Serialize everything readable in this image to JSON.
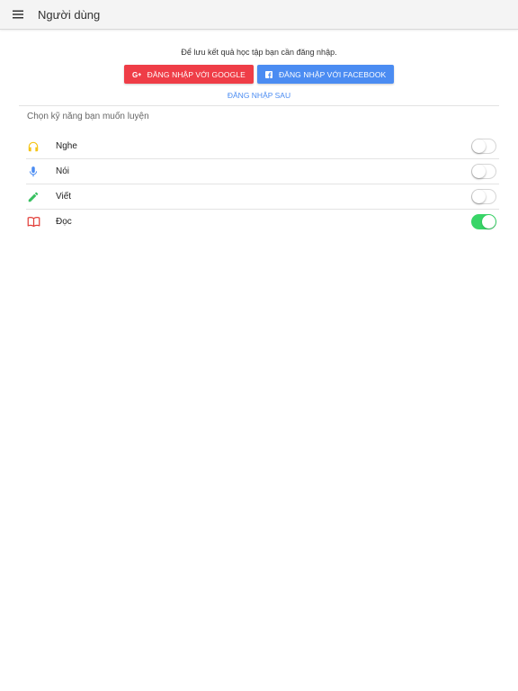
{
  "appbar": {
    "title": "Người dùng",
    "menu_icon": "menu-icon"
  },
  "login": {
    "message": "Để lưu kết quả học tập bạn cần đăng nhập.",
    "google_label": "ĐĂNG NHẬP VỚI GOOGLE",
    "google_icon": "google-plus-icon",
    "google_color": "#ef3d47",
    "facebook_label": "ĐĂNG NHẬP VỚI FACEBOOK",
    "facebook_icon": "facebook-icon",
    "facebook_color": "#4b8cf2",
    "later_label": "ĐĂNG NHẬP SAU"
  },
  "skills": {
    "section_label": "Chọn kỹ năng bạn muốn luyện",
    "items": [
      {
        "label": "Nghe",
        "icon": "headphones-icon",
        "icon_color": "#f5c518",
        "enabled": false
      },
      {
        "label": "Nói",
        "icon": "microphone-icon",
        "icon_color": "#4b8cf2",
        "enabled": false
      },
      {
        "label": "Viết",
        "icon": "pencil-icon",
        "icon_color": "#38c060",
        "enabled": false
      },
      {
        "label": "Đọc",
        "icon": "book-icon",
        "icon_color": "#e2403b",
        "enabled": true
      }
    ]
  },
  "toggle_on_color": "#38d567"
}
